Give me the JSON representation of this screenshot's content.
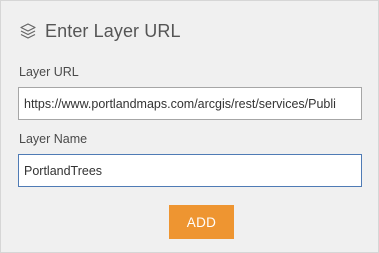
{
  "dialog": {
    "title": "Enter Layer URL",
    "icon": "layers-icon"
  },
  "form": {
    "layer_url_label": "Layer URL",
    "layer_url_value": "https://www.portlandmaps.com/arcgis/rest/services/Publi",
    "layer_name_label": "Layer Name",
    "layer_name_value": "PortlandTrees"
  },
  "actions": {
    "add_label": "ADD"
  },
  "colors": {
    "accent_button": "#ee9531",
    "panel_background": "#f0f0f0",
    "focused_border": "#4f7bb5"
  }
}
